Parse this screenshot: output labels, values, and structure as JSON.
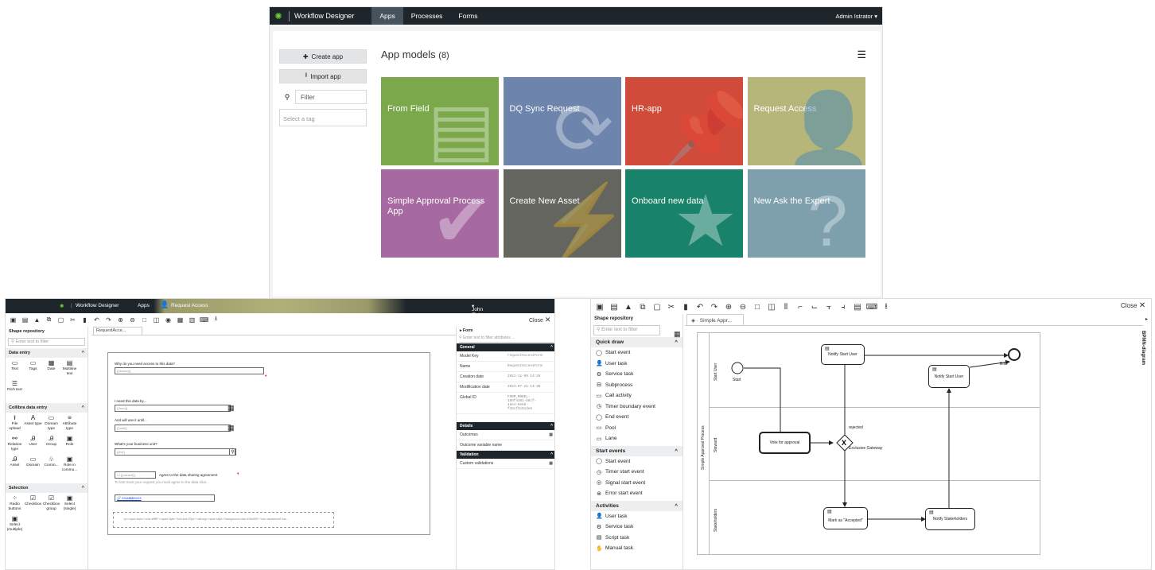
{
  "top_window": {
    "brand": "Workflow Designer",
    "tabs": [
      "Apps",
      "Processes",
      "Forms"
    ],
    "user": "Admin Istrator",
    "buttons": {
      "create_app": "Create app",
      "import_app": "Import app"
    },
    "filter_placeholder": "Filter",
    "tag_placeholder": "Select a tag",
    "title": "App models",
    "count": "(8)",
    "tiles": [
      {
        "label": "From Field",
        "color": "#7aa84a"
      },
      {
        "label": "DQ Sync Request",
        "color": "#6d84ad"
      },
      {
        "label": "HR-app",
        "color": "#d04b3a"
      },
      {
        "label": "Request Access",
        "color": "#b6b67a"
      },
      {
        "label": "Simple Approval Process App",
        "color": "#a769a1"
      },
      {
        "label": "Create New Asset",
        "color": "#656560"
      },
      {
        "label": "Onboard new data",
        "color": "#19826a"
      },
      {
        "label": "New Ask the Expert",
        "color": "#7ea0ad"
      }
    ]
  },
  "form_window": {
    "brand": "Workflow Designer",
    "tab": "Apps",
    "app_name": "Request Access",
    "user": "John Fisher",
    "close": "Close",
    "repo_title": "Shape repository",
    "repo_search": "Enter text to filter",
    "sections": [
      {
        "title": "Data entry",
        "items": [
          "Text",
          "Tags",
          "Date",
          "Multiline text",
          "Rich text"
        ]
      },
      {
        "title": "Collibra data entry",
        "items": [
          "File upload",
          "Asset type",
          "Domain type",
          "Attribute type",
          "Relation type",
          "User",
          "Group",
          "Role",
          "Asset",
          "Domain",
          "Comm...",
          "Role in commu..."
        ]
      },
      {
        "title": "Selection",
        "items": [
          "Radio buttons",
          "Checkbox",
          "Checkbox group",
          "Select (single)",
          "Select (multiple)"
        ]
      }
    ],
    "doc_tab": "RequestAcce...",
    "fields": {
      "q1": "Why do you need access to this data?",
      "q1_ph": "{{reason}}",
      "q2": "I need this data by...",
      "q2_ph": "{{from}}",
      "q3": "And will use it until...",
      "q3_ph": "{{until}}",
      "q4": "What's your business unit?",
      "q4_ph": "{{bu}}",
      "agree_ph": "{{valueof}}",
      "agree": "Agree to the data sharing agreement",
      "agree_note": "To fast track your request you must agree to the data shar...",
      "link": "DSA$$$N103",
      "html": "<p><span style=\"color:#ffffff\"><span style=\"font-size:20px\"><strong><span style=\"background-color:#16e050\">Your department has..."
    },
    "props": {
      "header": "Form",
      "search": "Enter text to filter attributes ...",
      "general": "General",
      "rows": [
        {
          "k": "Model Key",
          "v": "requestAccessForm"
        },
        {
          "k": "Name",
          "v": "RequestAccessForm"
        },
        {
          "k": "Creation date",
          "v": "2022-11-09 14:28"
        },
        {
          "k": "Modification date",
          "v": "2023-07-21 13:30"
        },
        {
          "k": "Global ID",
          "v": "FORM_MODEL-\n185f4381-b8cf-\n4de4-9e56-\nf15cf3c61de5"
        }
      ],
      "details": "Details",
      "outcomes": "Outcomes",
      "outcome_var": "Outcome variable name",
      "validation": "Validation",
      "custom_validations": "Custom validations"
    }
  },
  "process_window": {
    "close": "Close",
    "repo_title": "Shape repository",
    "repo_search": "Enter text to filter",
    "doc_tab": "Simple Appr...",
    "side_label": "BPMN-diagram",
    "sections": [
      {
        "title": "Quick draw",
        "items": [
          "Start event",
          "User task",
          "Service task",
          "Subprocess",
          "Call activity",
          "Timer boundary event",
          "End event",
          "Pool",
          "Lane"
        ]
      },
      {
        "title": "Start events",
        "items": [
          "Start event",
          "Timer start event",
          "Signal start event",
          "Error start event"
        ]
      },
      {
        "title": "Activities",
        "items": [
          "User task",
          "Service task",
          "Script task",
          "Manual task"
        ]
      }
    ],
    "diagram": {
      "pool": "Simple Approval Process",
      "lanes": [
        "Start User",
        "Steward",
        "Stakeholders"
      ],
      "start": "Start",
      "end": "End",
      "notify1": "Notify Start User",
      "notify2": "Notify Start User",
      "vote": "Vote for approval",
      "gateway": "Exclusive Gateway",
      "rejected": "rejected",
      "mark": "Mark as \"Accepted\"",
      "notify_stake": "Notify Stakeholders"
    }
  }
}
